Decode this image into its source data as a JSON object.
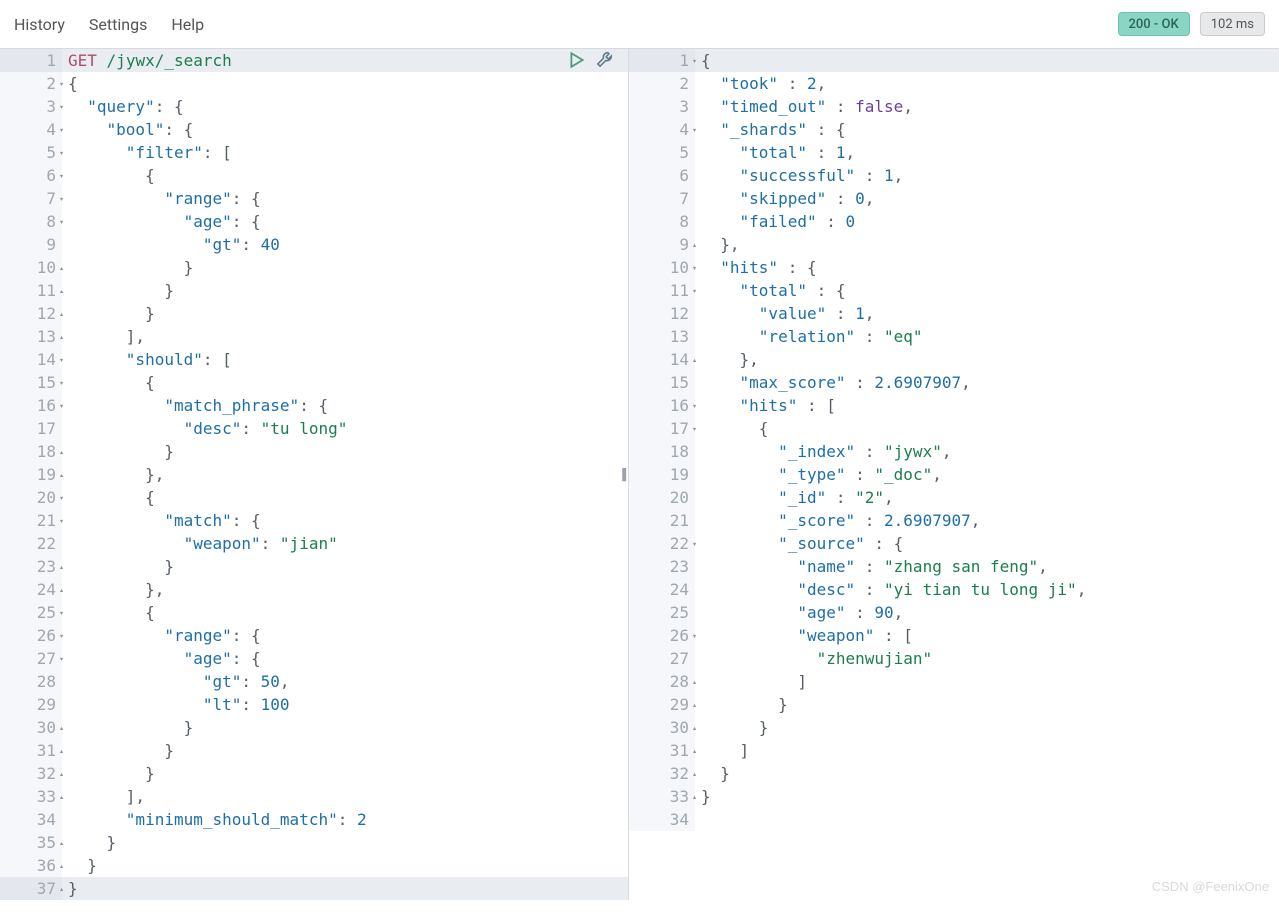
{
  "menu": {
    "history": "History",
    "settings": "Settings",
    "help": "Help"
  },
  "status": {
    "ok": "200 - OK",
    "time": "102 ms"
  },
  "watermark": "CSDN @FeenixOne",
  "request": {
    "lines": [
      {
        "n": 1,
        "fold": "",
        "hl": true,
        "tokens": [
          [
            "method",
            "GET"
          ],
          [
            "punc",
            " "
          ],
          [
            "str",
            "/jywx/_search"
          ]
        ]
      },
      {
        "n": 2,
        "fold": "o",
        "tokens": [
          [
            "punc",
            "{"
          ]
        ]
      },
      {
        "n": 3,
        "fold": "o",
        "tokens": [
          [
            "punc",
            "  "
          ],
          [
            "key",
            "\"query\""
          ],
          [
            "punc",
            ": {"
          ]
        ]
      },
      {
        "n": 4,
        "fold": "o",
        "tokens": [
          [
            "punc",
            "    "
          ],
          [
            "key",
            "\"bool\""
          ],
          [
            "punc",
            ": {"
          ]
        ]
      },
      {
        "n": 5,
        "fold": "o",
        "tokens": [
          [
            "punc",
            "      "
          ],
          [
            "key",
            "\"filter\""
          ],
          [
            "punc",
            ": ["
          ]
        ]
      },
      {
        "n": 6,
        "fold": "o",
        "tokens": [
          [
            "punc",
            "        {"
          ]
        ]
      },
      {
        "n": 7,
        "fold": "o",
        "tokens": [
          [
            "punc",
            "          "
          ],
          [
            "key",
            "\"range\""
          ],
          [
            "punc",
            ": {"
          ]
        ]
      },
      {
        "n": 8,
        "fold": "o",
        "tokens": [
          [
            "punc",
            "            "
          ],
          [
            "key",
            "\"age\""
          ],
          [
            "punc",
            ": {"
          ]
        ]
      },
      {
        "n": 9,
        "fold": "",
        "tokens": [
          [
            "punc",
            "              "
          ],
          [
            "key",
            "\"gt\""
          ],
          [
            "punc",
            ": "
          ],
          [
            "num",
            "40"
          ]
        ]
      },
      {
        "n": 10,
        "fold": "c",
        "tokens": [
          [
            "punc",
            "            }"
          ]
        ]
      },
      {
        "n": 11,
        "fold": "c",
        "tokens": [
          [
            "punc",
            "          }"
          ]
        ]
      },
      {
        "n": 12,
        "fold": "c",
        "tokens": [
          [
            "punc",
            "        }"
          ]
        ]
      },
      {
        "n": 13,
        "fold": "c",
        "tokens": [
          [
            "punc",
            "      ],"
          ]
        ]
      },
      {
        "n": 14,
        "fold": "o",
        "tokens": [
          [
            "punc",
            "      "
          ],
          [
            "key",
            "\"should\""
          ],
          [
            "punc",
            ": ["
          ]
        ]
      },
      {
        "n": 15,
        "fold": "o",
        "tokens": [
          [
            "punc",
            "        {"
          ]
        ]
      },
      {
        "n": 16,
        "fold": "o",
        "tokens": [
          [
            "punc",
            "          "
          ],
          [
            "key",
            "\"match_phrase\""
          ],
          [
            "punc",
            ": {"
          ]
        ]
      },
      {
        "n": 17,
        "fold": "",
        "tokens": [
          [
            "punc",
            "            "
          ],
          [
            "key",
            "\"desc\""
          ],
          [
            "punc",
            ": "
          ],
          [
            "str",
            "\"tu long\""
          ]
        ]
      },
      {
        "n": 18,
        "fold": "c",
        "tokens": [
          [
            "punc",
            "          }"
          ]
        ]
      },
      {
        "n": 19,
        "fold": "c",
        "tokens": [
          [
            "punc",
            "        },"
          ]
        ]
      },
      {
        "n": 20,
        "fold": "o",
        "tokens": [
          [
            "punc",
            "        {"
          ]
        ]
      },
      {
        "n": 21,
        "fold": "o",
        "tokens": [
          [
            "punc",
            "          "
          ],
          [
            "key",
            "\"match\""
          ],
          [
            "punc",
            ": {"
          ]
        ]
      },
      {
        "n": 22,
        "fold": "",
        "tokens": [
          [
            "punc",
            "            "
          ],
          [
            "key",
            "\"weapon\""
          ],
          [
            "punc",
            ": "
          ],
          [
            "str",
            "\"jian\""
          ]
        ]
      },
      {
        "n": 23,
        "fold": "c",
        "tokens": [
          [
            "punc",
            "          }"
          ]
        ]
      },
      {
        "n": 24,
        "fold": "c",
        "tokens": [
          [
            "punc",
            "        },"
          ]
        ]
      },
      {
        "n": 25,
        "fold": "o",
        "tokens": [
          [
            "punc",
            "        {"
          ]
        ]
      },
      {
        "n": 26,
        "fold": "o",
        "tokens": [
          [
            "punc",
            "          "
          ],
          [
            "key",
            "\"range\""
          ],
          [
            "punc",
            ": {"
          ]
        ]
      },
      {
        "n": 27,
        "fold": "o",
        "tokens": [
          [
            "punc",
            "            "
          ],
          [
            "key",
            "\"age\""
          ],
          [
            "punc",
            ": {"
          ]
        ]
      },
      {
        "n": 28,
        "fold": "",
        "tokens": [
          [
            "punc",
            "              "
          ],
          [
            "key",
            "\"gt\""
          ],
          [
            "punc",
            ": "
          ],
          [
            "num",
            "50"
          ],
          [
            "punc",
            ","
          ]
        ]
      },
      {
        "n": 29,
        "fold": "",
        "tokens": [
          [
            "punc",
            "              "
          ],
          [
            "key",
            "\"lt\""
          ],
          [
            "punc",
            ": "
          ],
          [
            "num",
            "100"
          ]
        ]
      },
      {
        "n": 30,
        "fold": "c",
        "tokens": [
          [
            "punc",
            "            }"
          ]
        ]
      },
      {
        "n": 31,
        "fold": "c",
        "tokens": [
          [
            "punc",
            "          }"
          ]
        ]
      },
      {
        "n": 32,
        "fold": "c",
        "tokens": [
          [
            "punc",
            "        }"
          ]
        ]
      },
      {
        "n": 33,
        "fold": "c",
        "tokens": [
          [
            "punc",
            "      ],"
          ]
        ]
      },
      {
        "n": 34,
        "fold": "",
        "tokens": [
          [
            "punc",
            "      "
          ],
          [
            "key",
            "\"minimum_should_match\""
          ],
          [
            "punc",
            ": "
          ],
          [
            "num",
            "2"
          ]
        ]
      },
      {
        "n": 35,
        "fold": "c",
        "tokens": [
          [
            "punc",
            "    }"
          ]
        ]
      },
      {
        "n": 36,
        "fold": "c",
        "tokens": [
          [
            "punc",
            "  }"
          ]
        ]
      },
      {
        "n": 37,
        "fold": "c",
        "hl": true,
        "tokens": [
          [
            "punc",
            "}"
          ]
        ]
      }
    ]
  },
  "response": {
    "lines": [
      {
        "n": 1,
        "fold": "o",
        "hl": true,
        "tokens": [
          [
            "punc",
            "{"
          ]
        ]
      },
      {
        "n": 2,
        "fold": "",
        "tokens": [
          [
            "punc",
            "  "
          ],
          [
            "field",
            "\"took\""
          ],
          [
            "punc",
            " : "
          ],
          [
            "num",
            "2"
          ],
          [
            "punc",
            ","
          ]
        ]
      },
      {
        "n": 3,
        "fold": "",
        "tokens": [
          [
            "punc",
            "  "
          ],
          [
            "field",
            "\"timed_out\""
          ],
          [
            "punc",
            " : "
          ],
          [
            "bool",
            "false"
          ],
          [
            "punc",
            ","
          ]
        ]
      },
      {
        "n": 4,
        "fold": "o",
        "tokens": [
          [
            "punc",
            "  "
          ],
          [
            "field",
            "\"_shards\""
          ],
          [
            "punc",
            " : {"
          ]
        ]
      },
      {
        "n": 5,
        "fold": "",
        "tokens": [
          [
            "punc",
            "    "
          ],
          [
            "field",
            "\"total\""
          ],
          [
            "punc",
            " : "
          ],
          [
            "num",
            "1"
          ],
          [
            "punc",
            ","
          ]
        ]
      },
      {
        "n": 6,
        "fold": "",
        "tokens": [
          [
            "punc",
            "    "
          ],
          [
            "field",
            "\"successful\""
          ],
          [
            "punc",
            " : "
          ],
          [
            "num",
            "1"
          ],
          [
            "punc",
            ","
          ]
        ]
      },
      {
        "n": 7,
        "fold": "",
        "tokens": [
          [
            "punc",
            "    "
          ],
          [
            "field",
            "\"skipped\""
          ],
          [
            "punc",
            " : "
          ],
          [
            "num",
            "0"
          ],
          [
            "punc",
            ","
          ]
        ]
      },
      {
        "n": 8,
        "fold": "",
        "tokens": [
          [
            "punc",
            "    "
          ],
          [
            "field",
            "\"failed\""
          ],
          [
            "punc",
            " : "
          ],
          [
            "num",
            "0"
          ]
        ]
      },
      {
        "n": 9,
        "fold": "c",
        "tokens": [
          [
            "punc",
            "  },"
          ]
        ]
      },
      {
        "n": 10,
        "fold": "o",
        "tokens": [
          [
            "punc",
            "  "
          ],
          [
            "field",
            "\"hits\""
          ],
          [
            "punc",
            " : {"
          ]
        ]
      },
      {
        "n": 11,
        "fold": "o",
        "tokens": [
          [
            "punc",
            "    "
          ],
          [
            "field",
            "\"total\""
          ],
          [
            "punc",
            " : {"
          ]
        ]
      },
      {
        "n": 12,
        "fold": "",
        "tokens": [
          [
            "punc",
            "      "
          ],
          [
            "field",
            "\"value\""
          ],
          [
            "punc",
            " : "
          ],
          [
            "num",
            "1"
          ],
          [
            "punc",
            ","
          ]
        ]
      },
      {
        "n": 13,
        "fold": "",
        "tokens": [
          [
            "punc",
            "      "
          ],
          [
            "field",
            "\"relation\""
          ],
          [
            "punc",
            " : "
          ],
          [
            "str",
            "\"eq\""
          ]
        ]
      },
      {
        "n": 14,
        "fold": "c",
        "tokens": [
          [
            "punc",
            "    },"
          ]
        ]
      },
      {
        "n": 15,
        "fold": "",
        "tokens": [
          [
            "punc",
            "    "
          ],
          [
            "field",
            "\"max_score\""
          ],
          [
            "punc",
            " : "
          ],
          [
            "num",
            "2.6907907"
          ],
          [
            "punc",
            ","
          ]
        ]
      },
      {
        "n": 16,
        "fold": "o",
        "tokens": [
          [
            "punc",
            "    "
          ],
          [
            "field",
            "\"hits\""
          ],
          [
            "punc",
            " : ["
          ]
        ]
      },
      {
        "n": 17,
        "fold": "o",
        "tokens": [
          [
            "punc",
            "      {"
          ]
        ]
      },
      {
        "n": 18,
        "fold": "",
        "tokens": [
          [
            "punc",
            "        "
          ],
          [
            "field",
            "\"_index\""
          ],
          [
            "punc",
            " : "
          ],
          [
            "str",
            "\"jywx\""
          ],
          [
            "punc",
            ","
          ]
        ]
      },
      {
        "n": 19,
        "fold": "",
        "tokens": [
          [
            "punc",
            "        "
          ],
          [
            "field",
            "\"_type\""
          ],
          [
            "punc",
            " : "
          ],
          [
            "str",
            "\"_doc\""
          ],
          [
            "punc",
            ","
          ]
        ]
      },
      {
        "n": 20,
        "fold": "",
        "tokens": [
          [
            "punc",
            "        "
          ],
          [
            "field",
            "\"_id\""
          ],
          [
            "punc",
            " : "
          ],
          [
            "str",
            "\"2\""
          ],
          [
            "punc",
            ","
          ]
        ]
      },
      {
        "n": 21,
        "fold": "",
        "tokens": [
          [
            "punc",
            "        "
          ],
          [
            "field",
            "\"_score\""
          ],
          [
            "punc",
            " : "
          ],
          [
            "num",
            "2.6907907"
          ],
          [
            "punc",
            ","
          ]
        ]
      },
      {
        "n": 22,
        "fold": "o",
        "tokens": [
          [
            "punc",
            "        "
          ],
          [
            "field",
            "\"_source\""
          ],
          [
            "punc",
            " : {"
          ]
        ]
      },
      {
        "n": 23,
        "fold": "",
        "tokens": [
          [
            "punc",
            "          "
          ],
          [
            "field",
            "\"name\""
          ],
          [
            "punc",
            " : "
          ],
          [
            "str",
            "\"zhang san feng\""
          ],
          [
            "punc",
            ","
          ]
        ]
      },
      {
        "n": 24,
        "fold": "",
        "tokens": [
          [
            "punc",
            "          "
          ],
          [
            "field",
            "\"desc\""
          ],
          [
            "punc",
            " : "
          ],
          [
            "str",
            "\"yi tian tu long ji\""
          ],
          [
            "punc",
            ","
          ]
        ]
      },
      {
        "n": 25,
        "fold": "",
        "tokens": [
          [
            "punc",
            "          "
          ],
          [
            "field",
            "\"age\""
          ],
          [
            "punc",
            " : "
          ],
          [
            "num",
            "90"
          ],
          [
            "punc",
            ","
          ]
        ]
      },
      {
        "n": 26,
        "fold": "o",
        "tokens": [
          [
            "punc",
            "          "
          ],
          [
            "field",
            "\"weapon\""
          ],
          [
            "punc",
            " : ["
          ]
        ]
      },
      {
        "n": 27,
        "fold": "",
        "tokens": [
          [
            "punc",
            "            "
          ],
          [
            "str",
            "\"zhenwujian\""
          ]
        ]
      },
      {
        "n": 28,
        "fold": "c",
        "tokens": [
          [
            "punc",
            "          ]"
          ]
        ]
      },
      {
        "n": 29,
        "fold": "c",
        "tokens": [
          [
            "punc",
            "        }"
          ]
        ]
      },
      {
        "n": 30,
        "fold": "c",
        "tokens": [
          [
            "punc",
            "      }"
          ]
        ]
      },
      {
        "n": 31,
        "fold": "c",
        "tokens": [
          [
            "punc",
            "    ]"
          ]
        ]
      },
      {
        "n": 32,
        "fold": "c",
        "tokens": [
          [
            "punc",
            "  }"
          ]
        ]
      },
      {
        "n": 33,
        "fold": "c",
        "tokens": [
          [
            "punc",
            "}"
          ]
        ]
      },
      {
        "n": 34,
        "fold": "",
        "tokens": [
          [
            "punc",
            ""
          ]
        ]
      }
    ]
  }
}
